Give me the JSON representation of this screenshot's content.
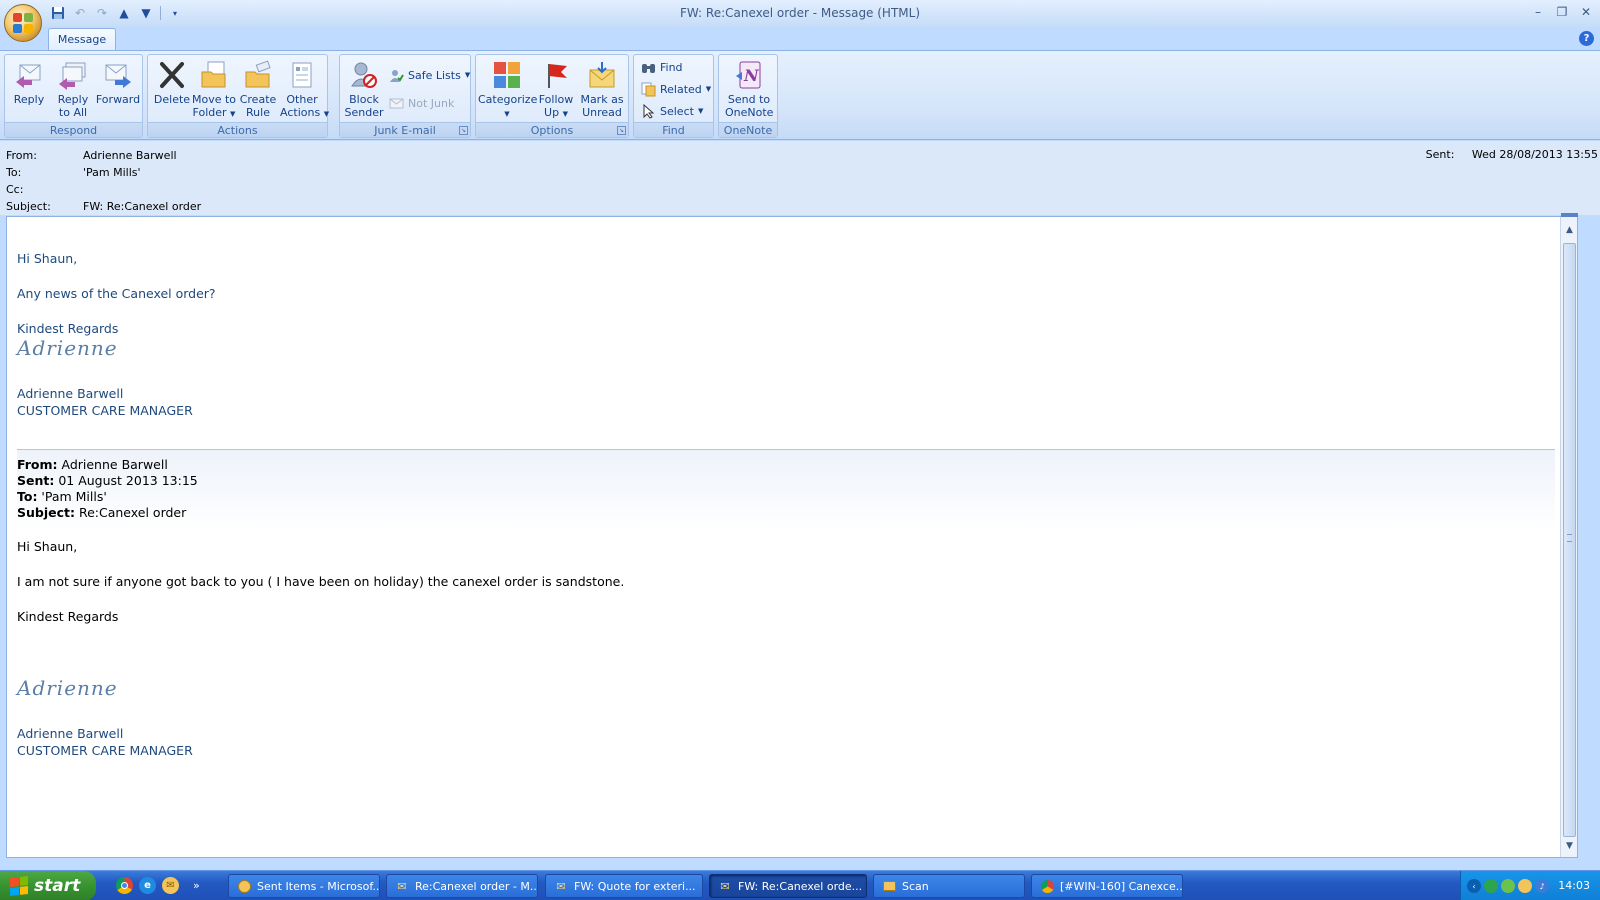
{
  "window": {
    "title": "FW: Re:Canexel order - Message (HTML)"
  },
  "tabs": {
    "message": "Message"
  },
  "ribbon": {
    "respond": {
      "label": "Respond",
      "reply": "Reply",
      "reply_all_1": "Reply",
      "reply_all_2": "to All",
      "forward": "Forward"
    },
    "actions": {
      "label": "Actions",
      "delete": "Delete",
      "move_1": "Move to",
      "move_2": "Folder",
      "rule_1": "Create",
      "rule_2": "Rule",
      "other_1": "Other",
      "other_2": "Actions"
    },
    "junk": {
      "label": "Junk E-mail",
      "block_1": "Block",
      "block_2": "Sender",
      "safe_lists": "Safe Lists",
      "not_junk": "Not Junk"
    },
    "options": {
      "label": "Options",
      "categorize": "Categorize",
      "follow_1": "Follow",
      "follow_2": "Up",
      "mark_1": "Mark as",
      "mark_2": "Unread"
    },
    "find": {
      "label": "Find",
      "find": "Find",
      "related": "Related",
      "select": "Select"
    },
    "onenote": {
      "label": "OneNote",
      "send_1": "Send to",
      "send_2": "OneNote"
    }
  },
  "header": {
    "from_label": "From:",
    "from_value": "Adrienne Barwell",
    "to_label": "To:",
    "to_value": "'Pam Mills'",
    "cc_label": "Cc:",
    "cc_value": "",
    "subject_label": "Subject:",
    "subject_value": "FW: Re:Canexel order",
    "sent_label": "Sent:",
    "sent_value": "Wed 28/08/2013 13:55"
  },
  "body": {
    "greeting": "Hi Shaun,",
    "line1": "Any news of the Canexel order?",
    "regards": "Kindest Regards",
    "signature": "Adrienne",
    "name": "Adrienne Barwell",
    "title": "CUSTOMER CARE MANAGER",
    "orig": {
      "from_label": "From:",
      "from_value": " Adrienne Barwell",
      "sent_label": "Sent:",
      "sent_value": " 01 August 2013 13:15",
      "to_label": "To:",
      "to_value": " 'Pam Mills'",
      "subject_label": "Subject:",
      "subject_value": " Re:Canexel order",
      "greeting": "Hi Shaun,",
      "line1": "I am not sure if anyone got back to you ( I have been on holiday) the canexel order is sandstone.",
      "regards": "Kindest Regards",
      "signature": "Adrienne",
      "name": "Adrienne Barwell",
      "title": "CUSTOMER CARE MANAGER"
    }
  },
  "taskbar": {
    "start": "start",
    "tasks": [
      "Sent Items - Microsof...",
      "Re:Canexel order - M...",
      "FW: Quote for exteri...",
      "FW: Re:Canexel orde...",
      "Scan",
      "[#WIN-160] Canexce..."
    ],
    "clock": "14:03"
  },
  "colors": {
    "ribbon_blue": "#bfdbff",
    "body_text_blue": "#1f497d",
    "taskbar_blue": "#2459c2",
    "start_green": "#37932f"
  }
}
